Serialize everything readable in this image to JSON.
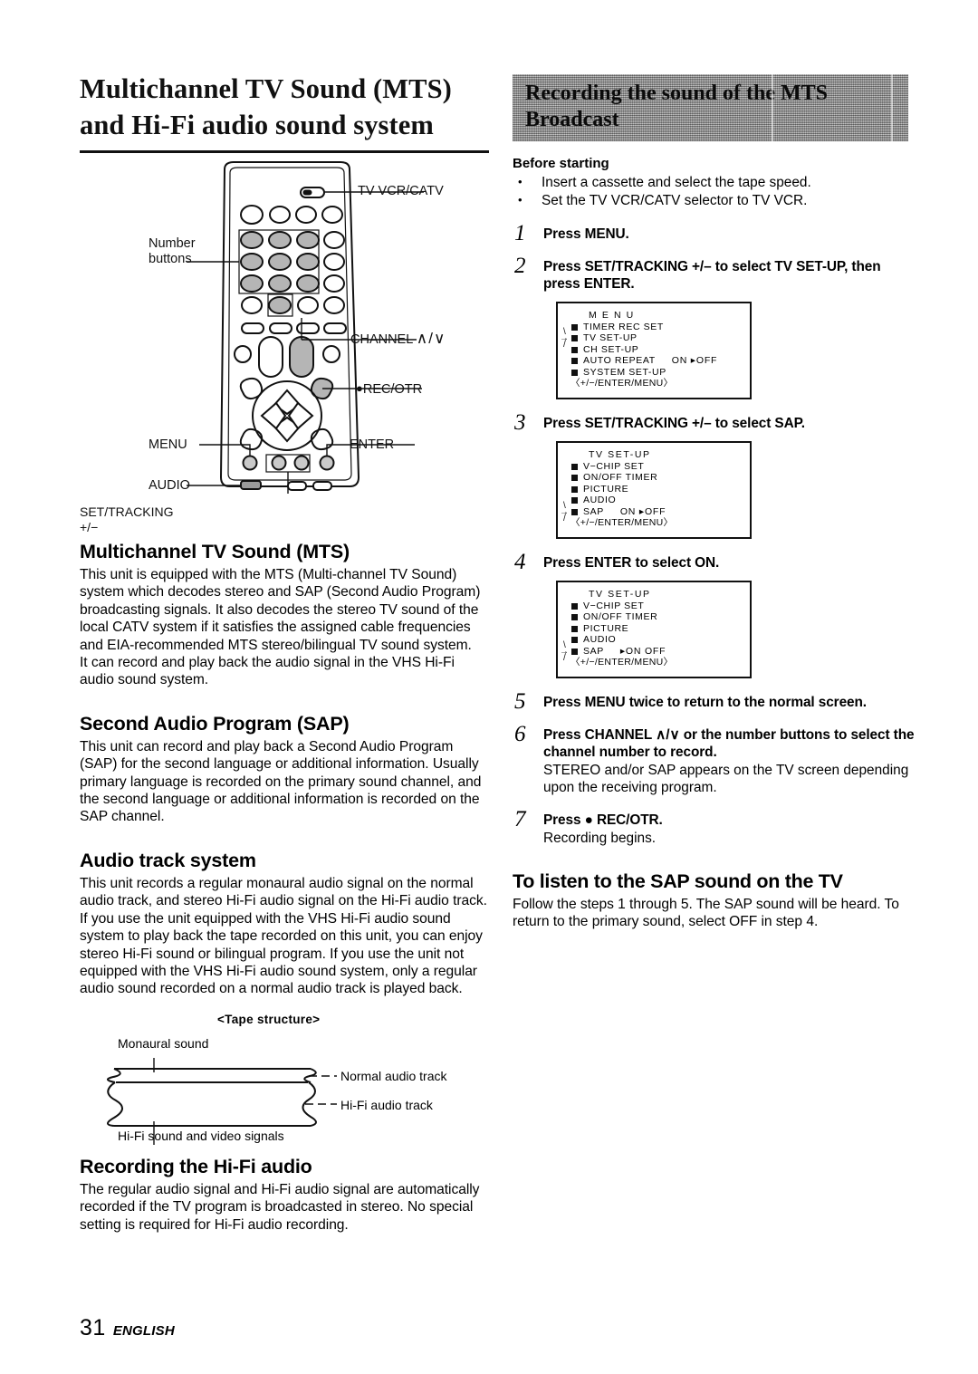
{
  "page": {
    "number": "31",
    "language": "ENGLISH"
  },
  "left": {
    "title": "Multichannel TV Sound (MTS) and Hi-Fi audio sound system",
    "remote_figure": {
      "labels": {
        "tv_vcr_catv": "TV VCR/CATV",
        "number_buttons_l1": "Number",
        "number_buttons_l2": "buttons",
        "channel": "CHANNEL",
        "channel_symbol": "∧/∨",
        "rec_otr": "REC/OTR",
        "menu": "MENU",
        "enter": "ENTER",
        "audio": "AUDIO",
        "set_tracking_l1": "SET/TRACKING",
        "set_tracking_l2": "+/−"
      }
    },
    "sections": [
      {
        "heading": "Multichannel TV Sound (MTS)",
        "paragraphs": [
          "This unit is equipped with the MTS (Multi-channel TV Sound) system which decodes stereo and SAP (Second Audio Program) broadcasting signals. It also decodes the stereo TV sound of the local CATV system if it satisfies the assigned cable frequencies and EIA-recommended MTS stereo/bilingual TV sound system.",
          "It can record and play back the audio signal in the VHS Hi-Fi audio sound system."
        ]
      },
      {
        "heading": "Second Audio Program (SAP)",
        "paragraphs": [
          "This unit can record and play back a Second Audio Program (SAP) for the second language or additional information. Usually primary language is recorded on the primary sound channel, and the second language or additional information is recorded on the SAP channel."
        ]
      },
      {
        "heading": "Audio track system",
        "paragraphs": [
          "This unit records a regular monaural audio signal on the normal audio track, and stereo Hi-Fi audio signal on the Hi-Fi audio track.",
          "If you use the unit equipped with the VHS Hi-Fi audio sound system to play back the tape recorded on this unit, you can enjoy stereo Hi-Fi sound or bilingual program. If you use the unit not equipped with the VHS Hi-Fi audio sound system, only a regular audio sound recorded on a normal audio track is played back."
        ]
      }
    ],
    "tape_figure": {
      "caption": "<Tape structure>",
      "monaural": "Monaural sound",
      "normal_track": "Normal audio track",
      "hifi_track": "Hi-Fi audio track",
      "hifi_video": "Hi-Fi sound and video signals"
    },
    "last_section": {
      "heading": "Recording the Hi-Fi audio",
      "paragraphs": [
        "The regular audio signal and Hi-Fi audio signal are automatically recorded if the TV program is broadcasted in stereo. No special setting is required for Hi-Fi audio recording."
      ]
    }
  },
  "right": {
    "banner_title": "Recording the sound of the MTS Broadcast",
    "before_starting": {
      "heading": "Before starting",
      "items": [
        "Insert a cassette and select the tape speed.",
        "Set the TV VCR/CATV selector to TV VCR."
      ]
    },
    "steps": [
      {
        "num": "1",
        "text": "Press MENU.",
        "sub": ""
      },
      {
        "num": "2",
        "text": "Press SET/TRACKING +/– to select TV SET-UP, then press ENTER.",
        "sub": ""
      },
      {
        "num": "3",
        "text": "Press SET/TRACKING +/– to select SAP.",
        "sub": ""
      },
      {
        "num": "4",
        "text": "Press ENTER to select ON.",
        "sub": ""
      },
      {
        "num": "5",
        "text": "Press MENU twice to return to the normal screen.",
        "sub": ""
      },
      {
        "num": "6",
        "text": "Press CHANNEL ∧/∨ or the number buttons to select the channel number to record.",
        "sub": "STEREO and/or SAP appears on the TV screen depending upon the receiving program."
      },
      {
        "num": "7",
        "text": "Press ● REC/OTR.",
        "sub": "Recording begins."
      }
    ],
    "osd_menus": [
      {
        "id": "menu-main",
        "title": "M E N U",
        "rows": [
          {
            "label": "TIMER REC SET",
            "value": ""
          },
          {
            "label": "TV SET-UP",
            "value": ""
          },
          {
            "label": "CH SET-UP",
            "value": ""
          },
          {
            "label": "AUTO REPEAT",
            "value": "ON ▸OFF"
          },
          {
            "label": "SYSTEM SET-UP",
            "value": ""
          }
        ],
        "hint": "〈+/−/ENTER/MENU〉",
        "cursor_row": 2
      },
      {
        "id": "menu-tv-setup-sap-off",
        "title": "TV SET-UP",
        "rows": [
          {
            "label": "V−CHIP SET",
            "value": ""
          },
          {
            "label": "ON/OFF TIMER",
            "value": ""
          },
          {
            "label": "PICTURE",
            "value": ""
          },
          {
            "label": "AUDIO",
            "value": ""
          },
          {
            "label": "SAP",
            "value": "ON ▸OFF"
          }
        ],
        "hint": "〈+/−/ENTER/MENU〉",
        "cursor_row": 5
      },
      {
        "id": "menu-tv-setup-sap-on",
        "title": "TV SET-UP",
        "rows": [
          {
            "label": "V−CHIP SET",
            "value": ""
          },
          {
            "label": "ON/OFF TIMER",
            "value": ""
          },
          {
            "label": "PICTURE",
            "value": ""
          },
          {
            "label": "AUDIO",
            "value": ""
          },
          {
            "label": "SAP",
            "value": "▸ON   OFF"
          }
        ],
        "hint": "〈+/−/ENTER/MENU〉",
        "cursor_row": 5
      }
    ],
    "sap_listen": {
      "heading": "To listen to the SAP sound on the TV",
      "paragraph": "Follow the steps 1 through 5. The SAP sound will be heard. To return to the primary sound, select OFF in step 4."
    }
  }
}
